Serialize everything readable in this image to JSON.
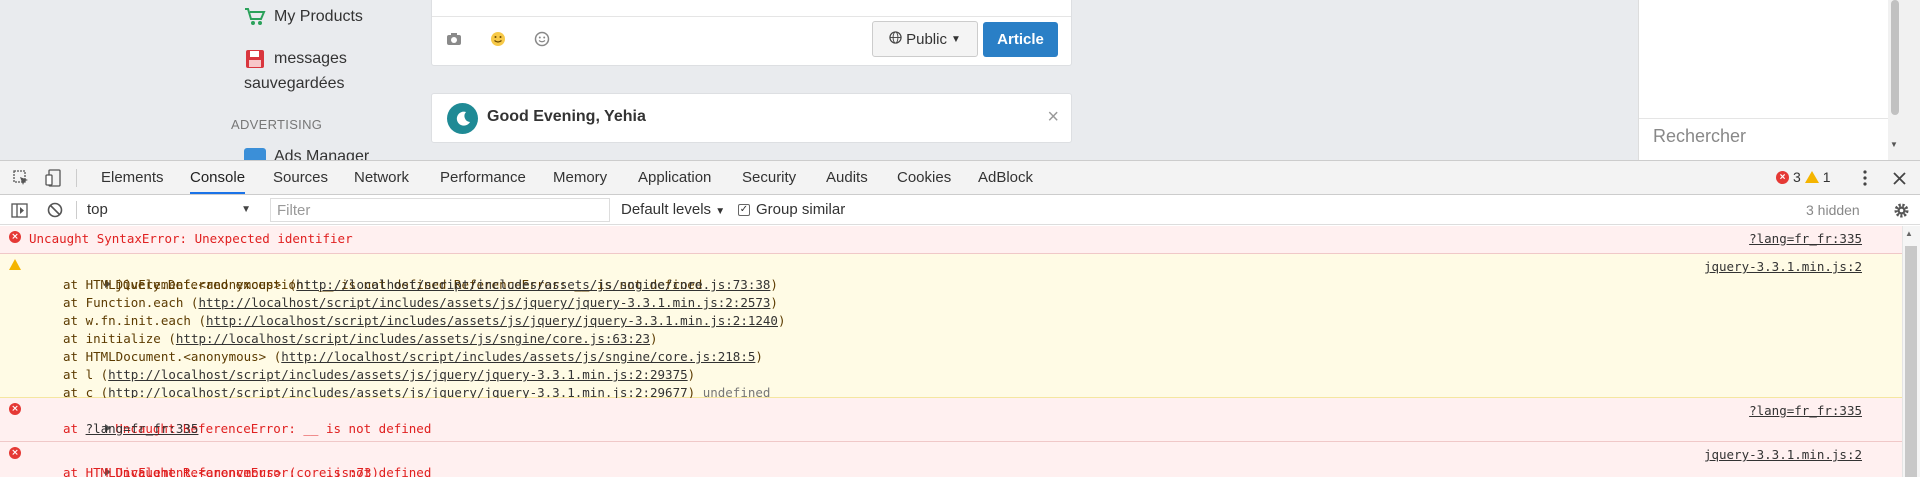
{
  "page": {
    "sidebar": {
      "my_products": "My Products",
      "saved_messages_line1": "messages",
      "saved_messages_line2": "sauvegardées",
      "advertising_header": "ADVERTISING",
      "ads_manager": "Ads Manager"
    },
    "composer": {
      "public_label": "Public",
      "article_label": "Article"
    },
    "greeting": {
      "text": "Good Evening, Yehia",
      "close": "×"
    },
    "right": {
      "search_placeholder": "Rechercher"
    }
  },
  "devtools": {
    "tabs": [
      "Elements",
      "Console",
      "Sources",
      "Network",
      "Performance",
      "Memory",
      "Application",
      "Security",
      "Audits",
      "Cookies",
      "AdBlock"
    ],
    "active_tab": "Console",
    "error_count": "3",
    "warning_count": "1",
    "toolbar": {
      "context": "top",
      "filter_placeholder": "Filter",
      "levels": "Default levels",
      "group_similar": "Group similar",
      "hidden": "3 hidden"
    },
    "messages": [
      {
        "level": "error",
        "text": "Uncaught SyntaxError: Unexpected identifier",
        "source": "?lang=fr_fr:335"
      },
      {
        "level": "warning",
        "text": "jQuery.Deferred exception: __ is not defined ReferenceError: __ is not defined",
        "source": "jquery-3.3.1.min.js:2",
        "stack": [
          {
            "pre": "at HTMLDivElement.<anonymous> (",
            "link": "http://localhost/script/includes/assets/js/sngine/core.js:73:38",
            "post": ")"
          },
          {
            "pre": "at Function.each (",
            "link": "http://localhost/script/includes/assets/js/jquery/jquery-3.3.1.min.js:2:2573",
            "post": ")"
          },
          {
            "pre": "at w.fn.init.each (",
            "link": "http://localhost/script/includes/assets/js/jquery/jquery-3.3.1.min.js:2:1240",
            "post": ")"
          },
          {
            "pre": "at initialize (",
            "link": "http://localhost/script/includes/assets/js/sngine/core.js:63:23",
            "post": ")"
          },
          {
            "pre": "at HTMLDocument.<anonymous> (",
            "link": "http://localhost/script/includes/assets/js/sngine/core.js:218:5",
            "post": ")"
          },
          {
            "pre": "at l (",
            "link": "http://localhost/script/includes/assets/js/jquery/jquery-3.3.1.min.js:2:29375",
            "post": ")"
          },
          {
            "pre": "at c (",
            "link": "http://localhost/script/includes/assets/js/jquery/jquery-3.3.1.min.js:2:29677",
            "post": ")",
            "tail": " undefined"
          }
        ]
      },
      {
        "level": "error",
        "text": "Uncaught ReferenceError: __ is not defined",
        "source": "?lang=fr_fr:335",
        "stack": [
          {
            "pre": "at ",
            "link": "?lang=fr_fr:335",
            "post": ""
          }
        ]
      },
      {
        "level": "error",
        "text": "Uncaught ReferenceError: __ is not defined",
        "source": "jquery-3.3.1.min.js:2",
        "stack": [
          {
            "pre": "at HTMLDivElement.<anonymous> (core.js:73)",
            "link": "",
            "post": ""
          }
        ]
      }
    ]
  },
  "colors": {
    "accent": "#1a73e8",
    "error": "#e02020",
    "warning_bg": "#fffbe5",
    "error_bg": "#fff0f0",
    "article_button": "#2a7fc6"
  }
}
